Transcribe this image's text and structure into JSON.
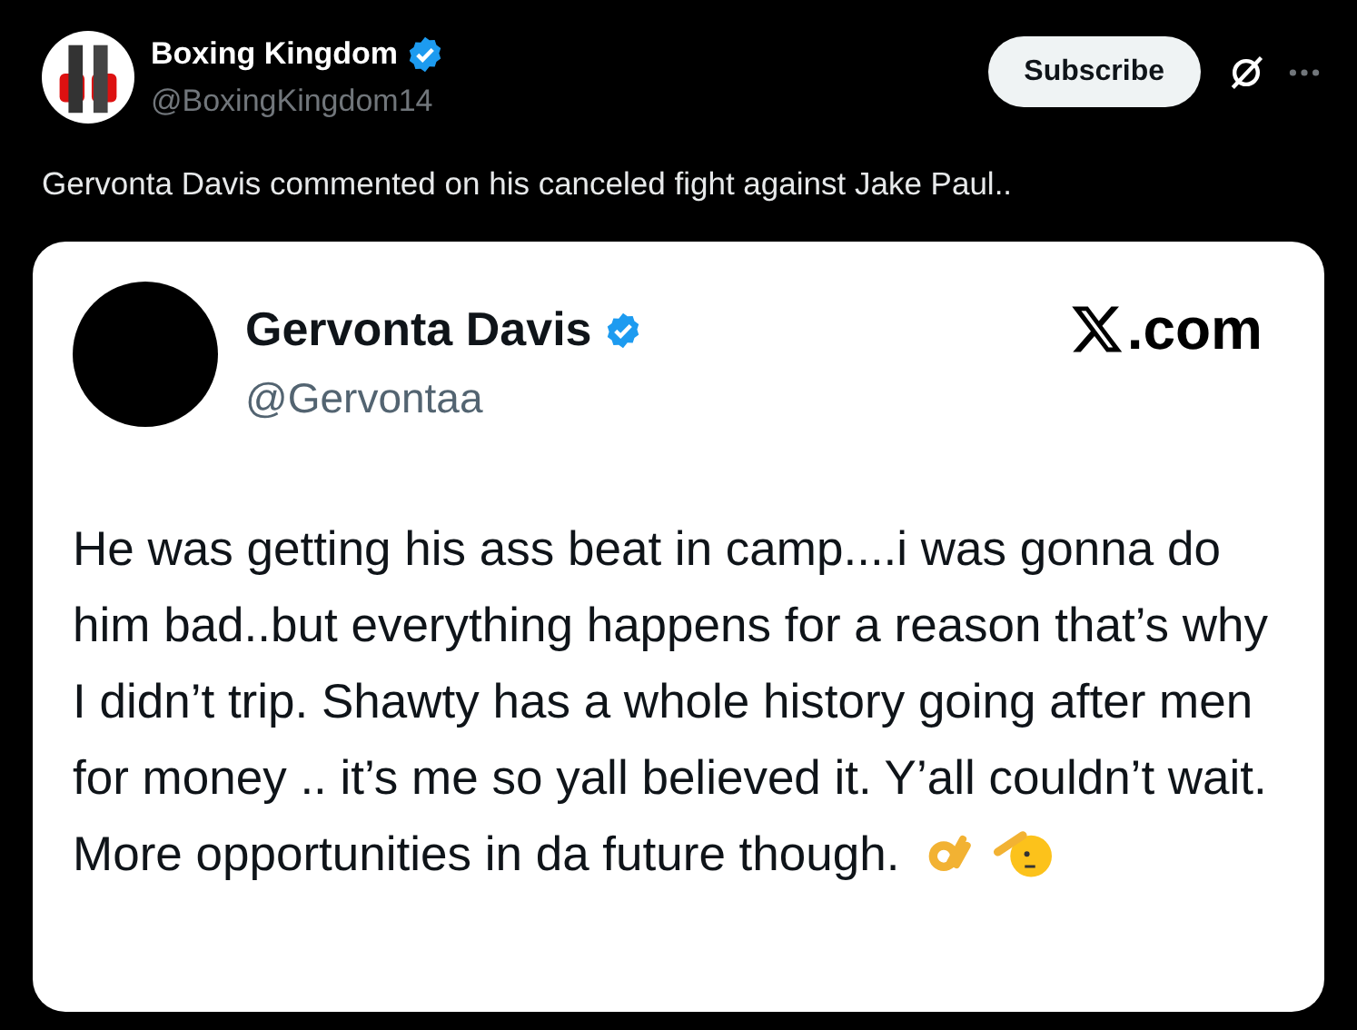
{
  "post": {
    "author": {
      "name": "Boxing Kingdom",
      "handle": "@BoxingKingdom14",
      "verified": true
    },
    "subscribe_button": "Subscribe",
    "text": "Gervonta Davis commented on his canceled fight against Jake Paul..",
    "embedded_post": {
      "author": {
        "name": "Gervonta Davis",
        "handle": "@Gervontaa",
        "verified": true
      },
      "site_suffix": ".com",
      "text": "He was getting his ass beat in camp....i was gonna do him bad..but everything happens for a reason that’s why I didn’t trip. Shawty has a whole history going after men for money .. it’s me so yall believed it. Y’all couldn’t wait. More opportunities in da future though."
    }
  }
}
